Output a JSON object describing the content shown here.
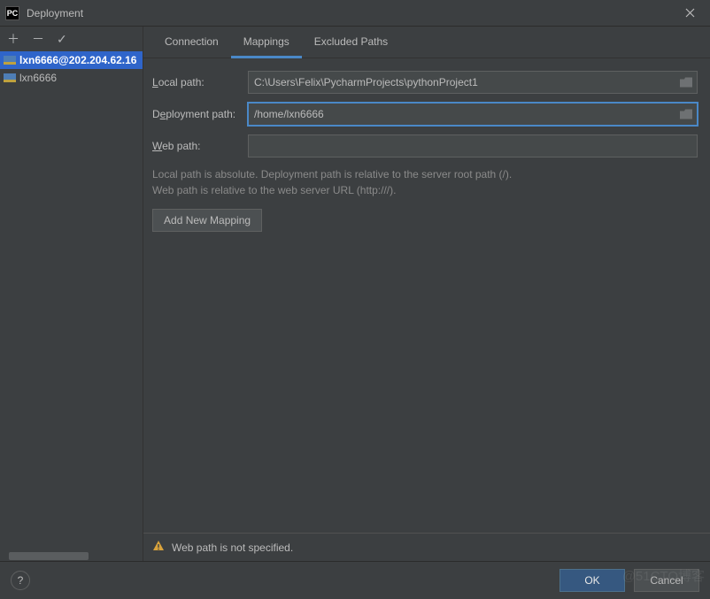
{
  "window": {
    "title": "Deployment"
  },
  "toolbar": {
    "add_tooltip": "Add",
    "remove_tooltip": "Remove",
    "check_tooltip": "Check"
  },
  "servers": [
    {
      "label": "lxn6666@202.204.62.16",
      "selected": true
    },
    {
      "label": "lxn6666",
      "selected": false
    }
  ],
  "tabs": {
    "connection": "Connection",
    "mappings": "Mappings",
    "excluded": "Excluded Paths",
    "active": "mappings"
  },
  "form": {
    "local_path_label": "Local path:",
    "local_path_value": "C:\\Users\\Felix\\PycharmProjects\\pythonProject1",
    "deployment_path_label": "Deployment path:",
    "deployment_path_value": "/home/lxn6666",
    "web_path_label": "Web path:",
    "web_path_value": ""
  },
  "help_text": {
    "line1": "Local path is absolute. Deployment path is relative to the server root path (/).",
    "line2": "Web path is relative to the web server URL (http:///)."
  },
  "buttons": {
    "add_mapping": "Add New Mapping",
    "ok": "OK",
    "cancel": "Cancel"
  },
  "warning": {
    "text": "Web path is not specified."
  },
  "watermark": "@51CTO博客"
}
